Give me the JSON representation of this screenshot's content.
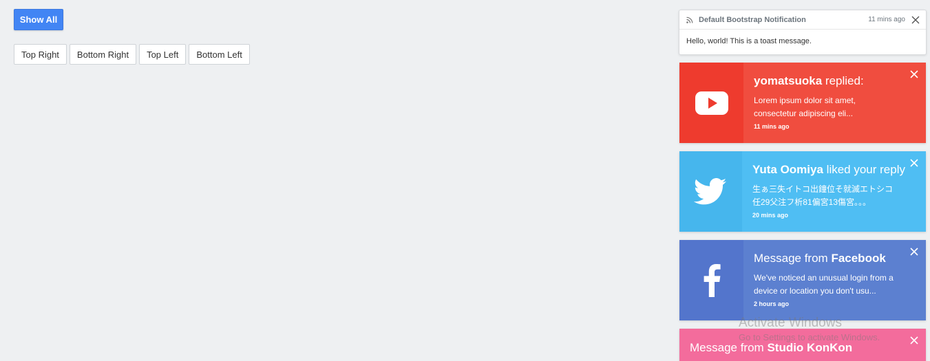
{
  "controls": {
    "show_all": "Show All",
    "positions": [
      "Top Right",
      "Bottom Right",
      "Top Left",
      "Bottom Left"
    ]
  },
  "bootstrap_toast": {
    "title": "Default Bootstrap Notification",
    "time": "11 mins ago",
    "body": "Hello, world! This is a toast message."
  },
  "toasts": [
    {
      "service": "youtube-icon",
      "name": "yomatsuoka",
      "action": " replied:",
      "message_line1": "Lorem ipsum dolor sit amet,",
      "message_line2": "consectetur adipiscing eli...",
      "time": "11 mins ago",
      "color": "#f04d3f"
    },
    {
      "service": "twitter-icon",
      "name": "Yuta Oomiya",
      "action": " liked your reply",
      "message_line1": "生ぁ三失イトコ出鐘位そ就滅エトシコ",
      "message_line2": "任29父注フ析81偏宮13傷宮。。。",
      "time": "20 mins ago",
      "color": "#4fbef3"
    },
    {
      "service": "facebook-icon",
      "prefix": "Message from ",
      "name": "Facebook",
      "message_line1": "We've noticed an unusual login from a",
      "message_line2": "device or location you don't usu...",
      "time": "2 hours ago",
      "color": "#5c80d0"
    },
    {
      "prefix": "Message from ",
      "name": "Studio KonKon",
      "color": "#f36c9c"
    }
  ],
  "watermark": {
    "line1": "Activate Windows",
    "line2": "Go to Settings to activate Windows."
  }
}
